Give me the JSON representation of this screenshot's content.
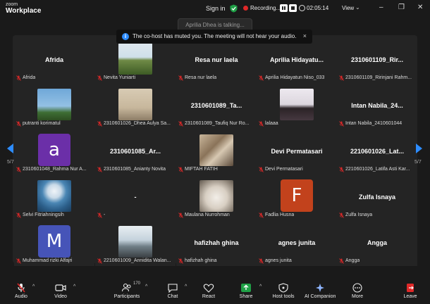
{
  "header": {
    "brand_small": "zoom",
    "brand_big": "Workplace",
    "signin": "Sign in",
    "recording": "Recording...",
    "timer": "02:05:14",
    "view": "View",
    "minimize": "–",
    "restore": "❐",
    "close": "✕"
  },
  "talking": "Aprilia Dhea is talking...",
  "notice": {
    "icon": "i",
    "text": "The co-host has muted you. The meeting will not hear your audio.",
    "close": "×"
  },
  "pagination": {
    "left": "5/7",
    "right": "5/7"
  },
  "colors": {
    "accent": "#2d8cff",
    "record": "#e02828",
    "muted": "#e02828"
  },
  "tiles": [
    {
      "kind": "name",
      "display": "Afrida",
      "label": "Afrida"
    },
    {
      "kind": "photo",
      "photo": "nature-hill",
      "label": "Nevita Yuniarti"
    },
    {
      "kind": "name",
      "display": "Resa nur laela",
      "label": "Resa nur laela"
    },
    {
      "kind": "name",
      "display": "Aprilia Hidayatu...",
      "label": "Aprilia Hidayatun Niso_033"
    },
    {
      "kind": "name",
      "display": "2310601109_Rir...",
      "label": "2310601109_Ririnjani Rahm..."
    },
    {
      "kind": "photo",
      "photo": "sky-tree",
      "label": "putranti korimatul"
    },
    {
      "kind": "photo",
      "photo": "room-wall",
      "label": "2310601026_Dhea Aulya Sa..."
    },
    {
      "kind": "name",
      "display": "2310601089_Ta...",
      "label": "2310601089_Taufiq Nur Ro..."
    },
    {
      "kind": "photo",
      "photo": "person-indoor",
      "label": "lalaaa"
    },
    {
      "kind": "name",
      "display": "Intan Nabila_24...",
      "label": "Intan Nabila_2410601044"
    },
    {
      "kind": "letter",
      "letter": "a",
      "color": "#6b2fa8",
      "label": "2310601048_Rahma Nur A..."
    },
    {
      "kind": "name",
      "display": "2310601085_Ar...",
      "label": "2310601085_Anianty Novita"
    },
    {
      "kind": "photo",
      "photo": "group-room",
      "label": "MIFTAH FATIH"
    },
    {
      "kind": "name",
      "display": "Devi Permatasari",
      "label": "Devi Permatasari"
    },
    {
      "kind": "name",
      "display": "2210601026_Lat...",
      "label": "2210601026_Latifa Asti Kar..."
    },
    {
      "kind": "photo",
      "photo": "peacock",
      "label": "Selvi Fitriahningsih"
    },
    {
      "kind": "name",
      "display": "-",
      "label": "-"
    },
    {
      "kind": "photo",
      "photo": "cat",
      "label": "Maulana Nurrohman"
    },
    {
      "kind": "letter",
      "letter": "F",
      "color": "#c2421c",
      "label": "Fadlia Husna"
    },
    {
      "kind": "name",
      "display": "Zulfa Isnaya",
      "label": "Zulfa Isnaya"
    },
    {
      "kind": "letter",
      "letter": "M",
      "color": "#4654b8",
      "label": "Muhammad rizki Alfajri"
    },
    {
      "kind": "photo",
      "photo": "person-outdoor",
      "label": "2210601009_Annidita Walan..."
    },
    {
      "kind": "name",
      "display": "hafizhah ghina",
      "label": "hafizhah ghina"
    },
    {
      "kind": "name",
      "display": "agnes junita",
      "label": "agnes junita"
    },
    {
      "kind": "name",
      "display": "Angga",
      "label": "Angga"
    }
  ],
  "toolbar": {
    "audio": "Audio",
    "video": "Video",
    "participants": "Participants",
    "participants_count": "170",
    "chat": "Chat",
    "react": "React",
    "share": "Share",
    "host_tools": "Host tools",
    "ai_companion": "AI Companion",
    "more": "More",
    "leave": "Leave"
  }
}
